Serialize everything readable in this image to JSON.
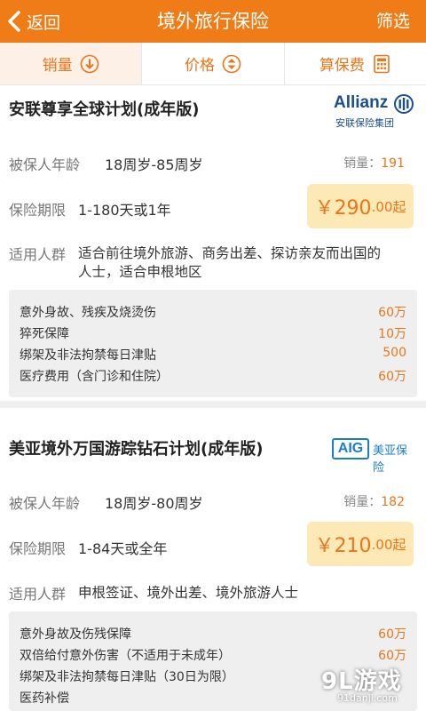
{
  "header": {
    "back_label": "返回",
    "title": "境外旅行保险",
    "filter_label": "筛选"
  },
  "sort_bar": {
    "items": [
      {
        "label": "销量"
      },
      {
        "label": "价格"
      },
      {
        "label": "算保费"
      }
    ]
  },
  "products": [
    {
      "name": "安联尊享全球计划(成年版)",
      "logo_text": "Allianz",
      "logo_sub": "安联保险集团",
      "age_label": "被保人年龄",
      "age_value": "18周岁-85周岁",
      "sales_label": "销量：",
      "sales_value": "191",
      "period_label": "保险期限",
      "period_value": "1-180天或1年",
      "price_main": "￥290",
      "price_suffix": ".00起",
      "group_label": "适用人群",
      "group_line1": "适合前往境外旅游、商务出差、探访亲友而出国的",
      "group_line2": "人士，适合申根地区",
      "coverage": [
        {
          "item": "意外身故、残疾及烧烫伤",
          "amount": "60万"
        },
        {
          "item": "猝死保障",
          "amount": "10万"
        },
        {
          "item": "绑架及非法拘禁每日津贴",
          "amount": "500"
        },
        {
          "item": "医疗费用（含门诊和住院）",
          "amount": "60万"
        }
      ]
    },
    {
      "name": "美亚境外万国游踪钻石计划(成年版)",
      "logo_text": "AIG",
      "logo_sub": "美亚保险",
      "age_label": "被保人年龄",
      "age_value": "18周岁-80周岁",
      "sales_label": "销量：",
      "sales_value": "182",
      "period_label": "保险期限",
      "period_value": "1-84天或全年",
      "price_main": "￥210",
      "price_suffix": ".00起",
      "group_label": "适用人群",
      "group_line1": "申根签证、境外出差、境外旅游人士",
      "coverage": [
        {
          "item": "意外身故及伤残保障",
          "amount": "60万"
        },
        {
          "item": "双倍给付意外伤害（不适用于未成年）",
          "amount": "60万"
        },
        {
          "item": "绑架及非法拘禁每日津贴（30日为限）",
          "amount": ""
        },
        {
          "item": "医药补偿",
          "amount": ""
        }
      ]
    }
  ],
  "watermark": {
    "main": "9L游戏",
    "sub": "91danji.com"
  }
}
